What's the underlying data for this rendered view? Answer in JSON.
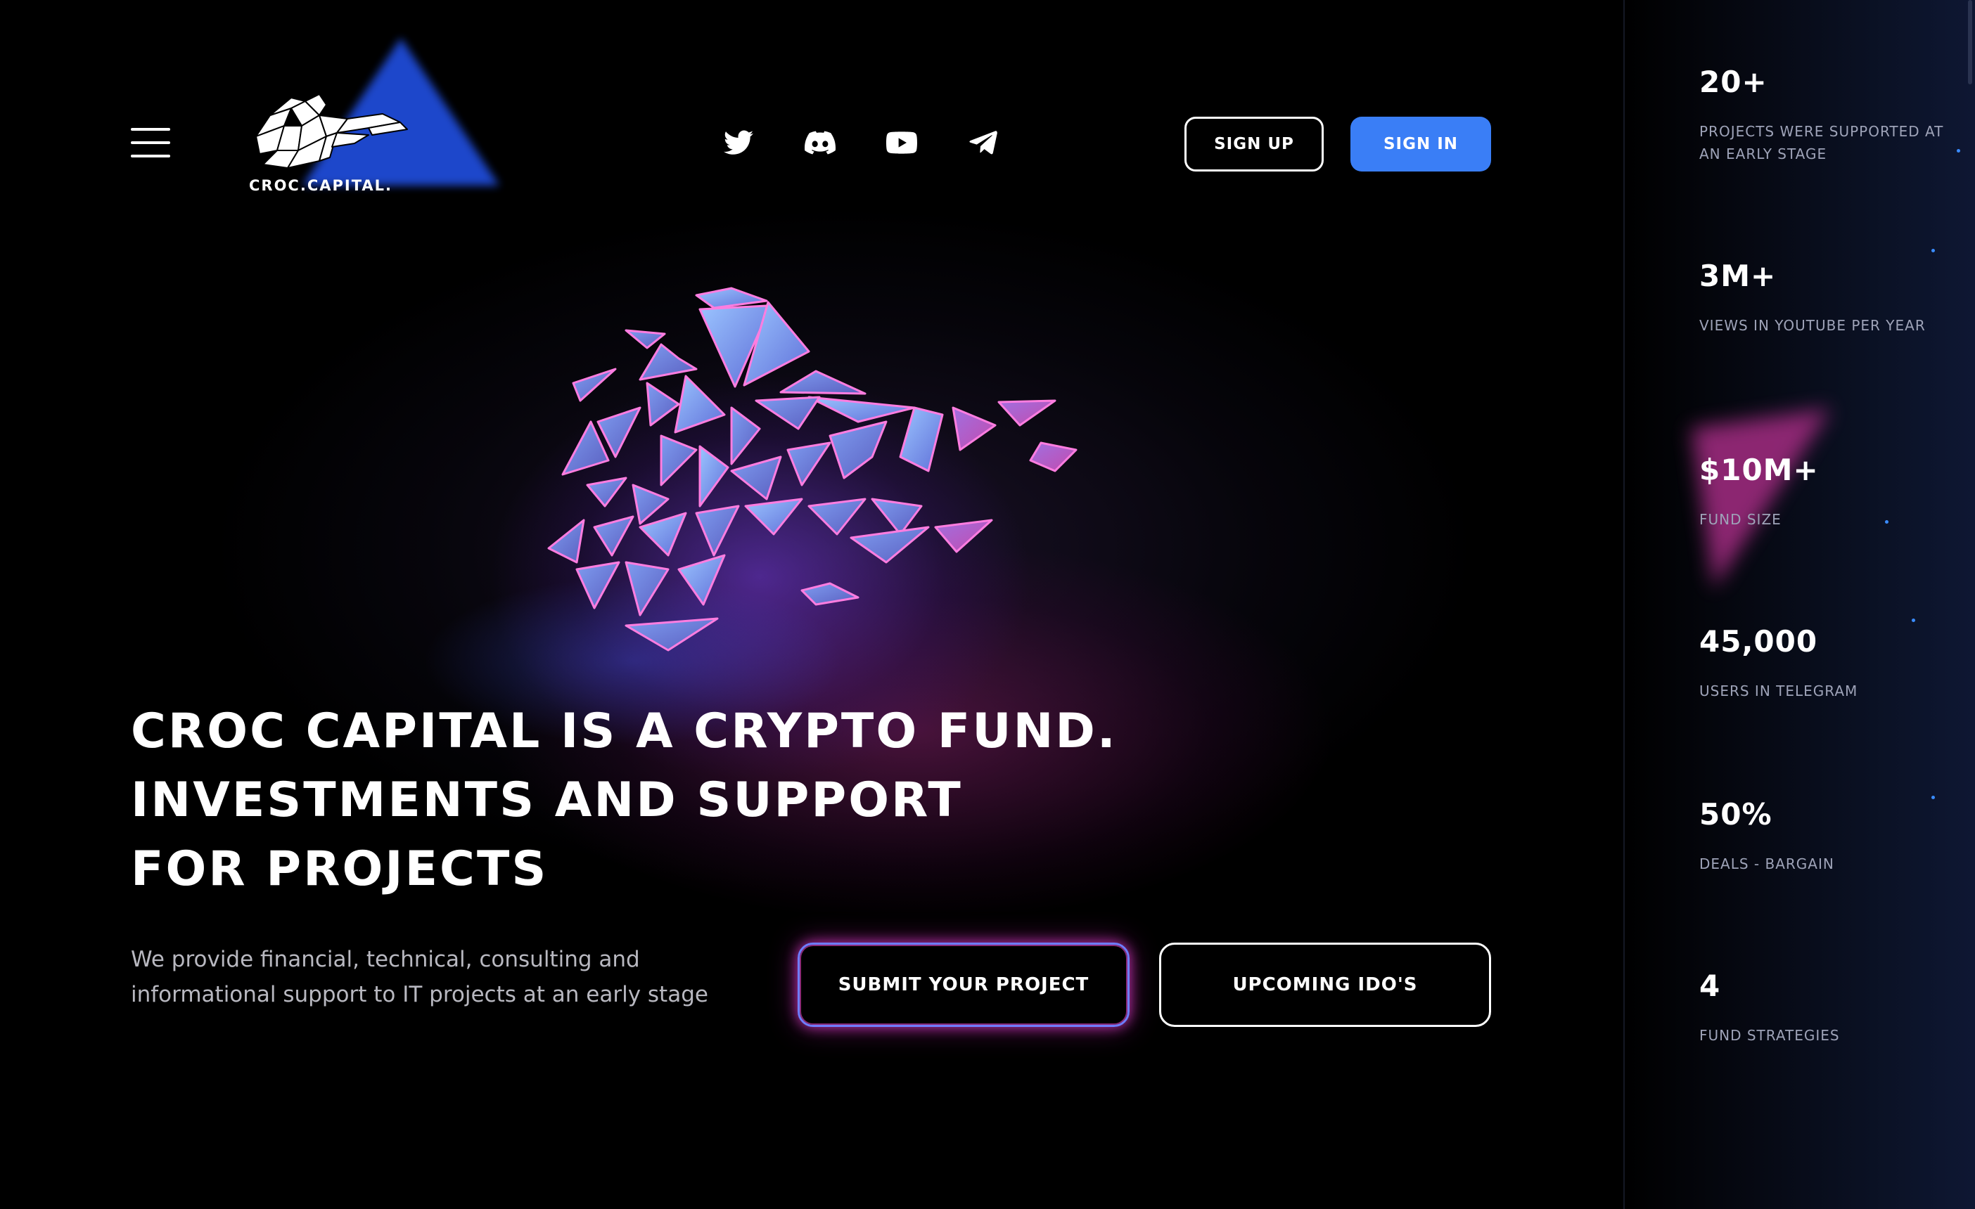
{
  "header": {
    "menu_icon": "hamburger-menu-icon",
    "logo_text": "CROC.CAPITAL.",
    "socials": [
      {
        "icon": "twitter-icon"
      },
      {
        "icon": "discord-icon"
      },
      {
        "icon": "youtube-icon"
      },
      {
        "icon": "telegram-icon"
      }
    ],
    "signup_label": "SIGN UP",
    "signin_label": "SIGN IN"
  },
  "hero": {
    "title_lines": [
      "CROC CAPITAL IS A CRYPTO FUND.",
      "INVESTMENTS AND SUPPORT",
      "FOR PROJECTS"
    ],
    "description": "We provide financial, technical, consulting and informational support to IT projects at an early stage",
    "submit_label": "SUBMIT YOUR PROJECT",
    "ido_label": "UPCOMING IDO'S"
  },
  "stats": [
    {
      "value": "20+",
      "label": "PROJECTS WERE SUPPORTED AT AN EARLY STAGE"
    },
    {
      "value": "3M+",
      "label": "VIEWS IN YOUTUBE PER YEAR"
    },
    {
      "value": "$10M+",
      "label": "FUND SIZE"
    },
    {
      "value": "45,000",
      "label": "USERS IN TELEGRAM"
    },
    {
      "value": "50%",
      "label": "DEALS - BARGAIN"
    },
    {
      "value": "4",
      "label": "FUND STRATEGIES"
    }
  ],
  "colors": {
    "accent_blue": "#3a7ef6",
    "glow_pink": "#d63cc8",
    "glow_violet": "#6f7dff",
    "background": "#000000"
  }
}
